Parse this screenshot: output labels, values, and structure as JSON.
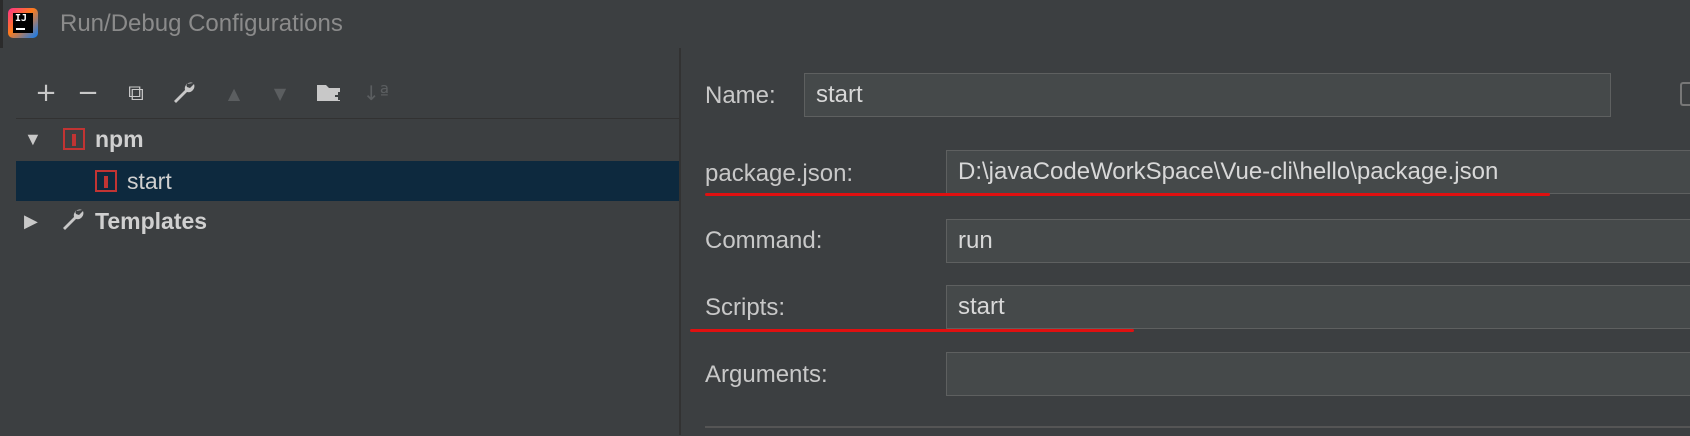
{
  "window": {
    "title": "Run/Debug Configurations",
    "logo_text": "IJ"
  },
  "toolbar": {
    "add": "+",
    "remove": "−",
    "copy": "⧉",
    "edit_defaults": "🔧",
    "move_up": "▲",
    "move_down": "▼",
    "new_folder": "📁",
    "sort": "↓ª"
  },
  "tree": {
    "npm": {
      "label": "npm",
      "expanded": true
    },
    "start": {
      "label": "start",
      "selected": true
    },
    "templates": {
      "label": "Templates",
      "expanded": false
    }
  },
  "form": {
    "name": {
      "label": "Name:",
      "value": "start"
    },
    "package_json": {
      "label": "package.json:",
      "value": "D:\\javaCodeWorkSpace\\Vue-cli\\hello\\package.json"
    },
    "command": {
      "label": "Command:",
      "value": "run"
    },
    "scripts": {
      "label": "Scripts:",
      "value": "start"
    },
    "arguments": {
      "label": "Arguments:",
      "value": ""
    }
  },
  "colors": {
    "background": "#3c3f41",
    "selection": "#0d293e",
    "field": "#45494a",
    "annotation_red": "#e01010",
    "npm_red": "#c13433"
  }
}
